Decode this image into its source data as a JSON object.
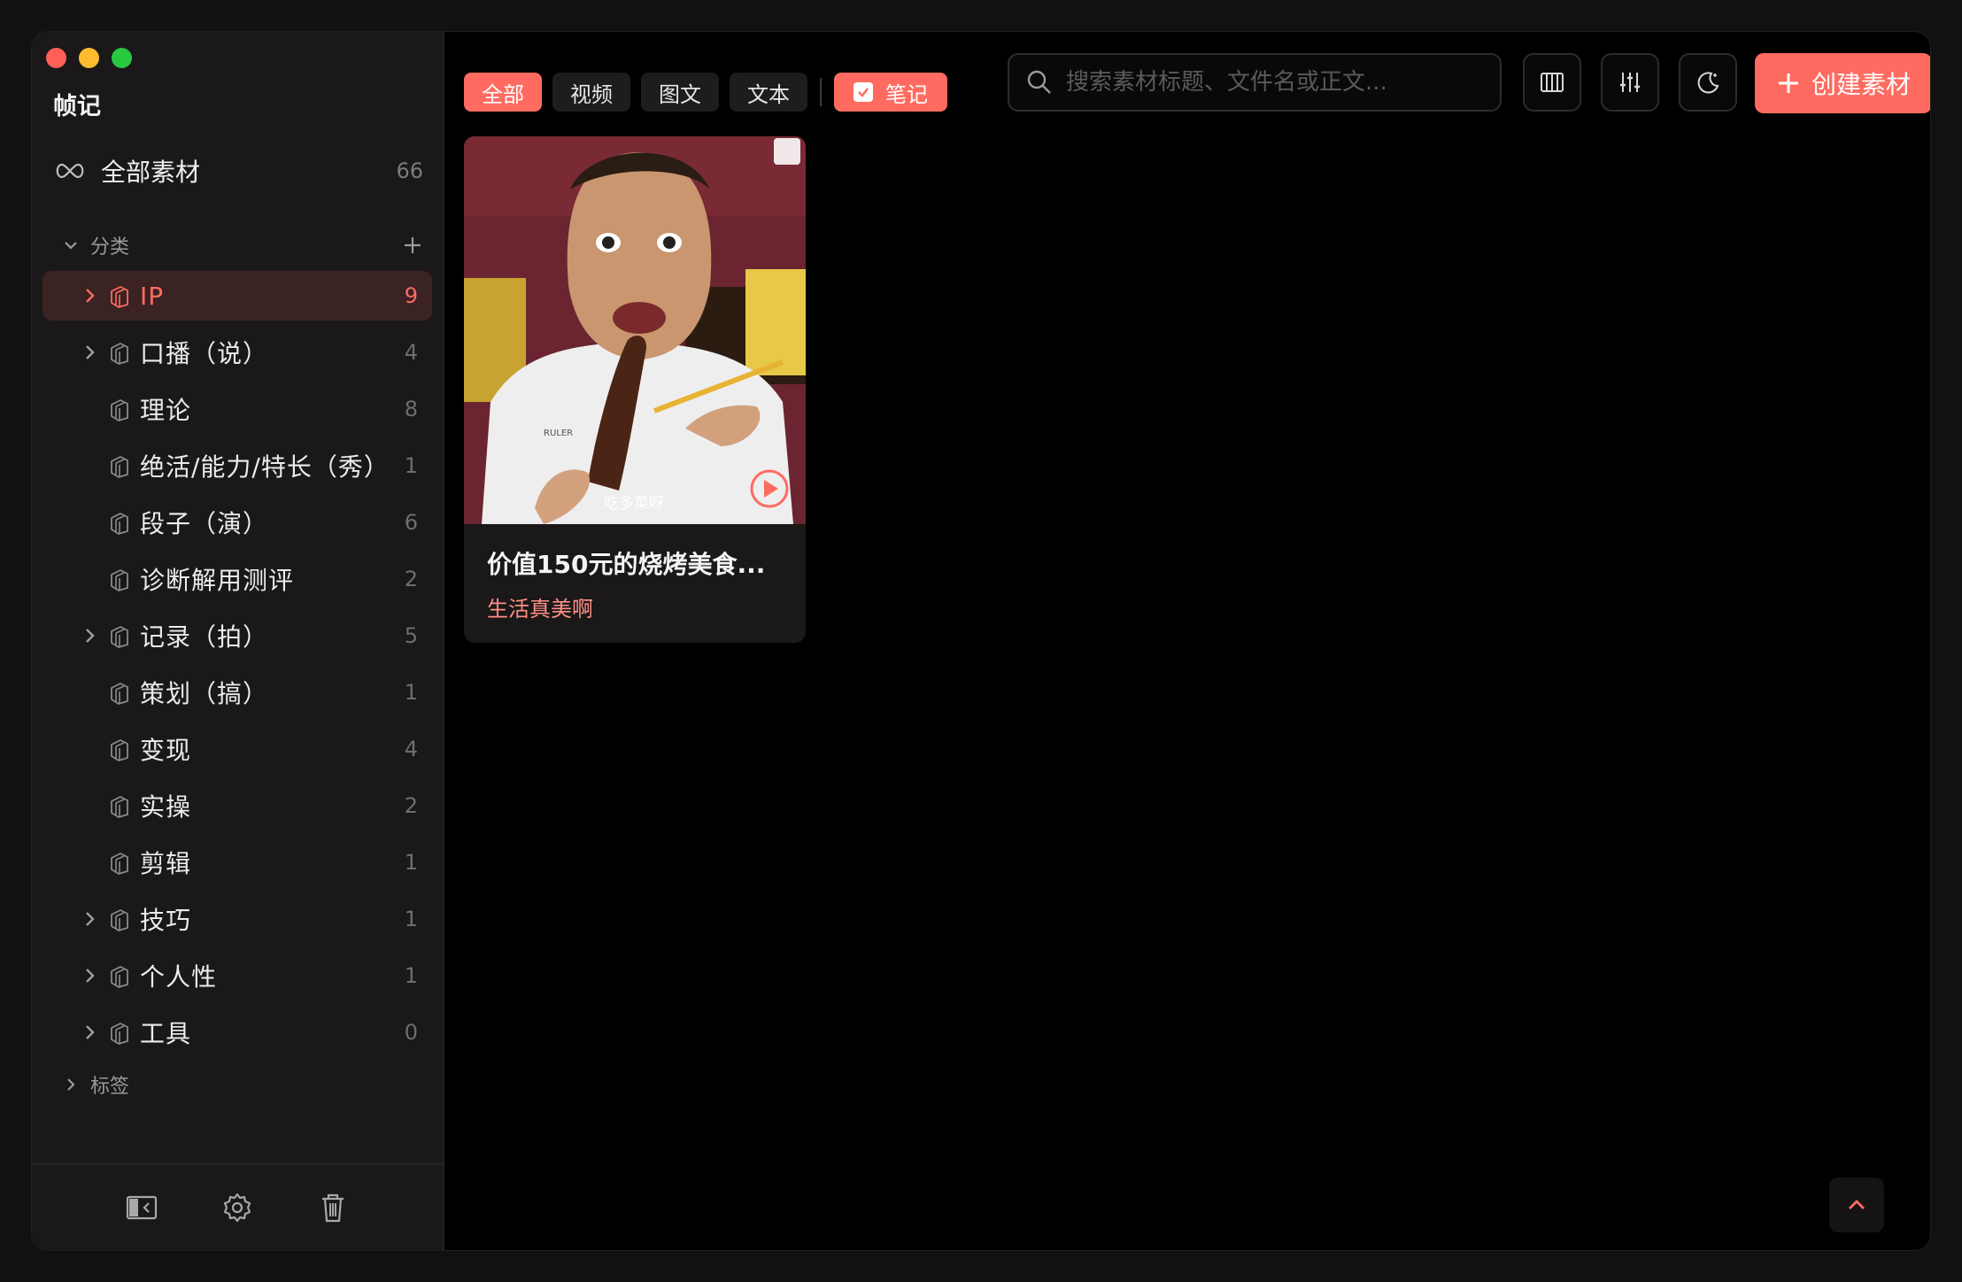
{
  "app": {
    "title": "帧记"
  },
  "sidebar": {
    "all": {
      "label": "全部素材",
      "count": "66"
    },
    "category_header": "分类",
    "tag_header": "标签",
    "categories": [
      {
        "label": "IP",
        "count": "9",
        "expandable": true,
        "active": true
      },
      {
        "label": "口播（说）",
        "count": "4",
        "expandable": true,
        "active": false
      },
      {
        "label": "理论",
        "count": "8",
        "expandable": false,
        "active": false
      },
      {
        "label": "绝活/能力/特长（秀）",
        "count": "1",
        "expandable": false,
        "active": false
      },
      {
        "label": "段子（演）",
        "count": "6",
        "expandable": false,
        "active": false
      },
      {
        "label": "诊断解用测评",
        "count": "2",
        "expandable": false,
        "active": false
      },
      {
        "label": "记录（拍）",
        "count": "5",
        "expandable": true,
        "active": false
      },
      {
        "label": "策划（搞）",
        "count": "1",
        "expandable": false,
        "active": false
      },
      {
        "label": "变现",
        "count": "4",
        "expandable": false,
        "active": false
      },
      {
        "label": "实操",
        "count": "2",
        "expandable": false,
        "active": false
      },
      {
        "label": "剪辑",
        "count": "1",
        "expandable": false,
        "active": false
      },
      {
        "label": "技巧",
        "count": "1",
        "expandable": true,
        "active": false
      },
      {
        "label": "个人性",
        "count": "1",
        "expandable": true,
        "active": false
      },
      {
        "label": "工具",
        "count": "0",
        "expandable": true,
        "active": false
      }
    ],
    "footer_icons": [
      "collapse-sidebar-icon",
      "gear-icon",
      "trash-icon"
    ]
  },
  "filters": {
    "all": "全部",
    "video": "视频",
    "image_text": "图文",
    "text": "文本",
    "note": "笔记"
  },
  "search": {
    "placeholder": "搜索素材标题、文件名或正文..."
  },
  "toolbar": {
    "columns_icon": "columns-icon",
    "sliders_icon": "sliders-icon",
    "theme_icon": "moon-icon",
    "create_label": "创建素材"
  },
  "cards": [
    {
      "title": "价值150元的烧烤美食...",
      "subtitle": "生活真美啊",
      "caption": "吃多菜呀",
      "shirt_text": "RULER"
    }
  ],
  "colors": {
    "accent": "#ff6b61",
    "sidebar_bg": "#1a1818",
    "active_row_bg": "#3a2322"
  }
}
